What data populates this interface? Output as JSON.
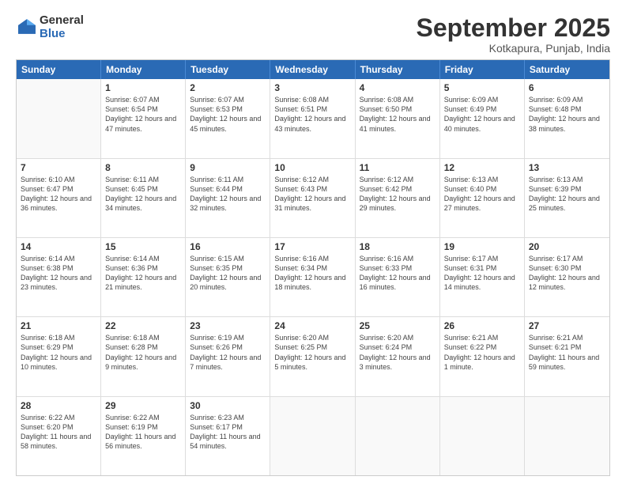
{
  "logo": {
    "general": "General",
    "blue": "Blue"
  },
  "title": "September 2025",
  "location": "Kotkapura, Punjab, India",
  "header_days": [
    "Sunday",
    "Monday",
    "Tuesday",
    "Wednesday",
    "Thursday",
    "Friday",
    "Saturday"
  ],
  "weeks": [
    [
      {
        "day": "",
        "sunrise": "",
        "sunset": "",
        "daylight": ""
      },
      {
        "day": "1",
        "sunrise": "Sunrise: 6:07 AM",
        "sunset": "Sunset: 6:54 PM",
        "daylight": "Daylight: 12 hours and 47 minutes."
      },
      {
        "day": "2",
        "sunrise": "Sunrise: 6:07 AM",
        "sunset": "Sunset: 6:53 PM",
        "daylight": "Daylight: 12 hours and 45 minutes."
      },
      {
        "day": "3",
        "sunrise": "Sunrise: 6:08 AM",
        "sunset": "Sunset: 6:51 PM",
        "daylight": "Daylight: 12 hours and 43 minutes."
      },
      {
        "day": "4",
        "sunrise": "Sunrise: 6:08 AM",
        "sunset": "Sunset: 6:50 PM",
        "daylight": "Daylight: 12 hours and 41 minutes."
      },
      {
        "day": "5",
        "sunrise": "Sunrise: 6:09 AM",
        "sunset": "Sunset: 6:49 PM",
        "daylight": "Daylight: 12 hours and 40 minutes."
      },
      {
        "day": "6",
        "sunrise": "Sunrise: 6:09 AM",
        "sunset": "Sunset: 6:48 PM",
        "daylight": "Daylight: 12 hours and 38 minutes."
      }
    ],
    [
      {
        "day": "7",
        "sunrise": "Sunrise: 6:10 AM",
        "sunset": "Sunset: 6:47 PM",
        "daylight": "Daylight: 12 hours and 36 minutes."
      },
      {
        "day": "8",
        "sunrise": "Sunrise: 6:11 AM",
        "sunset": "Sunset: 6:45 PM",
        "daylight": "Daylight: 12 hours and 34 minutes."
      },
      {
        "day": "9",
        "sunrise": "Sunrise: 6:11 AM",
        "sunset": "Sunset: 6:44 PM",
        "daylight": "Daylight: 12 hours and 32 minutes."
      },
      {
        "day": "10",
        "sunrise": "Sunrise: 6:12 AM",
        "sunset": "Sunset: 6:43 PM",
        "daylight": "Daylight: 12 hours and 31 minutes."
      },
      {
        "day": "11",
        "sunrise": "Sunrise: 6:12 AM",
        "sunset": "Sunset: 6:42 PM",
        "daylight": "Daylight: 12 hours and 29 minutes."
      },
      {
        "day": "12",
        "sunrise": "Sunrise: 6:13 AM",
        "sunset": "Sunset: 6:40 PM",
        "daylight": "Daylight: 12 hours and 27 minutes."
      },
      {
        "day": "13",
        "sunrise": "Sunrise: 6:13 AM",
        "sunset": "Sunset: 6:39 PM",
        "daylight": "Daylight: 12 hours and 25 minutes."
      }
    ],
    [
      {
        "day": "14",
        "sunrise": "Sunrise: 6:14 AM",
        "sunset": "Sunset: 6:38 PM",
        "daylight": "Daylight: 12 hours and 23 minutes."
      },
      {
        "day": "15",
        "sunrise": "Sunrise: 6:14 AM",
        "sunset": "Sunset: 6:36 PM",
        "daylight": "Daylight: 12 hours and 21 minutes."
      },
      {
        "day": "16",
        "sunrise": "Sunrise: 6:15 AM",
        "sunset": "Sunset: 6:35 PM",
        "daylight": "Daylight: 12 hours and 20 minutes."
      },
      {
        "day": "17",
        "sunrise": "Sunrise: 6:16 AM",
        "sunset": "Sunset: 6:34 PM",
        "daylight": "Daylight: 12 hours and 18 minutes."
      },
      {
        "day": "18",
        "sunrise": "Sunrise: 6:16 AM",
        "sunset": "Sunset: 6:33 PM",
        "daylight": "Daylight: 12 hours and 16 minutes."
      },
      {
        "day": "19",
        "sunrise": "Sunrise: 6:17 AM",
        "sunset": "Sunset: 6:31 PM",
        "daylight": "Daylight: 12 hours and 14 minutes."
      },
      {
        "day": "20",
        "sunrise": "Sunrise: 6:17 AM",
        "sunset": "Sunset: 6:30 PM",
        "daylight": "Daylight: 12 hours and 12 minutes."
      }
    ],
    [
      {
        "day": "21",
        "sunrise": "Sunrise: 6:18 AM",
        "sunset": "Sunset: 6:29 PM",
        "daylight": "Daylight: 12 hours and 10 minutes."
      },
      {
        "day": "22",
        "sunrise": "Sunrise: 6:18 AM",
        "sunset": "Sunset: 6:28 PM",
        "daylight": "Daylight: 12 hours and 9 minutes."
      },
      {
        "day": "23",
        "sunrise": "Sunrise: 6:19 AM",
        "sunset": "Sunset: 6:26 PM",
        "daylight": "Daylight: 12 hours and 7 minutes."
      },
      {
        "day": "24",
        "sunrise": "Sunrise: 6:20 AM",
        "sunset": "Sunset: 6:25 PM",
        "daylight": "Daylight: 12 hours and 5 minutes."
      },
      {
        "day": "25",
        "sunrise": "Sunrise: 6:20 AM",
        "sunset": "Sunset: 6:24 PM",
        "daylight": "Daylight: 12 hours and 3 minutes."
      },
      {
        "day": "26",
        "sunrise": "Sunrise: 6:21 AM",
        "sunset": "Sunset: 6:22 PM",
        "daylight": "Daylight: 12 hours and 1 minute."
      },
      {
        "day": "27",
        "sunrise": "Sunrise: 6:21 AM",
        "sunset": "Sunset: 6:21 PM",
        "daylight": "Daylight: 11 hours and 59 minutes."
      }
    ],
    [
      {
        "day": "28",
        "sunrise": "Sunrise: 6:22 AM",
        "sunset": "Sunset: 6:20 PM",
        "daylight": "Daylight: 11 hours and 58 minutes."
      },
      {
        "day": "29",
        "sunrise": "Sunrise: 6:22 AM",
        "sunset": "Sunset: 6:19 PM",
        "daylight": "Daylight: 11 hours and 56 minutes."
      },
      {
        "day": "30",
        "sunrise": "Sunrise: 6:23 AM",
        "sunset": "Sunset: 6:17 PM",
        "daylight": "Daylight: 11 hours and 54 minutes."
      },
      {
        "day": "",
        "sunrise": "",
        "sunset": "",
        "daylight": ""
      },
      {
        "day": "",
        "sunrise": "",
        "sunset": "",
        "daylight": ""
      },
      {
        "day": "",
        "sunrise": "",
        "sunset": "",
        "daylight": ""
      },
      {
        "day": "",
        "sunrise": "",
        "sunset": "",
        "daylight": ""
      }
    ]
  ]
}
